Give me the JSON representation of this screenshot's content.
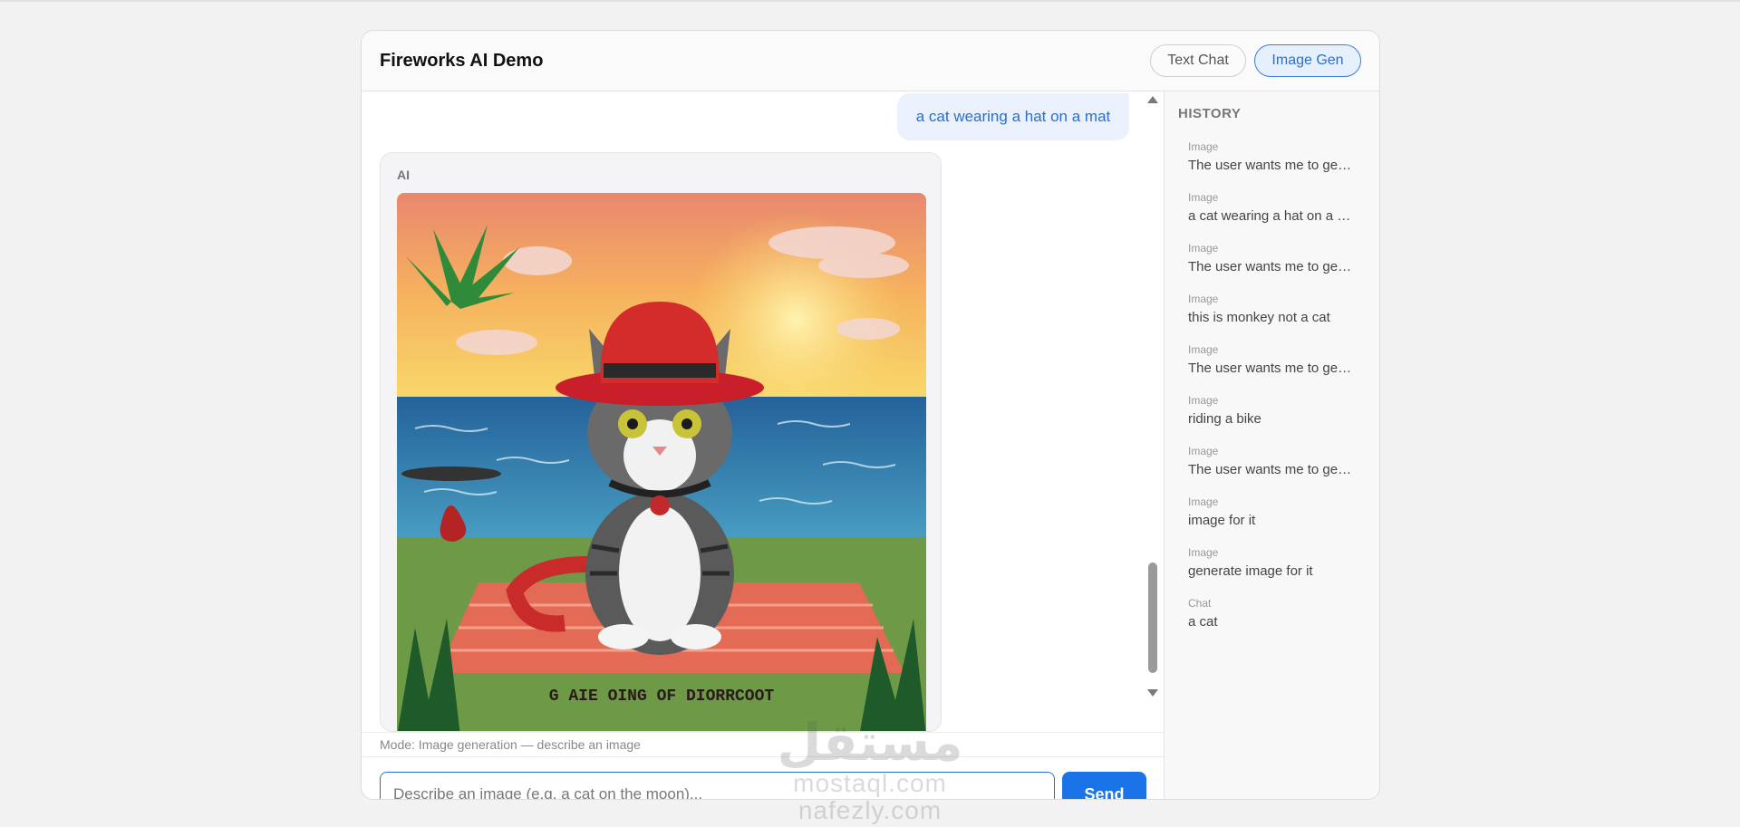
{
  "app": {
    "title": "Fireworks AI Demo",
    "modes": {
      "text_chat": "Text Chat",
      "image_gen": "Image Gen",
      "active": "Image Gen"
    }
  },
  "chat": {
    "user_message": "a cat wearing a hat on a mat",
    "ai_label": "AI",
    "image_caption_text": "G AIE OING OF DIORRCOOT",
    "mode_line": "Mode: Image generation — describe an image",
    "input": {
      "value": "",
      "placeholder": "Describe an image (e.g. a cat on the moon)..."
    },
    "send_label": "Send"
  },
  "history": {
    "title": "HISTORY",
    "items": [
      {
        "kind": "Image",
        "text": "The user wants me to ge…"
      },
      {
        "kind": "Image",
        "text": "a cat wearing a hat on a …"
      },
      {
        "kind": "Image",
        "text": "The user wants me to ge…"
      },
      {
        "kind": "Image",
        "text": "this is monkey not a cat"
      },
      {
        "kind": "Image",
        "text": "The user wants me to ge…"
      },
      {
        "kind": "Image",
        "text": "riding a bike"
      },
      {
        "kind": "Image",
        "text": "The user wants me to ge…"
      },
      {
        "kind": "Image",
        "text": "image for it"
      },
      {
        "kind": "Image",
        "text": "generate image for it"
      },
      {
        "kind": "Chat",
        "text": "a cat"
      }
    ]
  },
  "watermark": {
    "logo": "مستقل",
    "line1": "mostaql.com",
    "line2": "nafezly.com"
  },
  "colors": {
    "accent": "#1a73e8",
    "accent_soft": "#eaf1fc",
    "sky_top": "#f2a06f",
    "sea": "#2f7aa8",
    "hat": "#d02a2a"
  }
}
